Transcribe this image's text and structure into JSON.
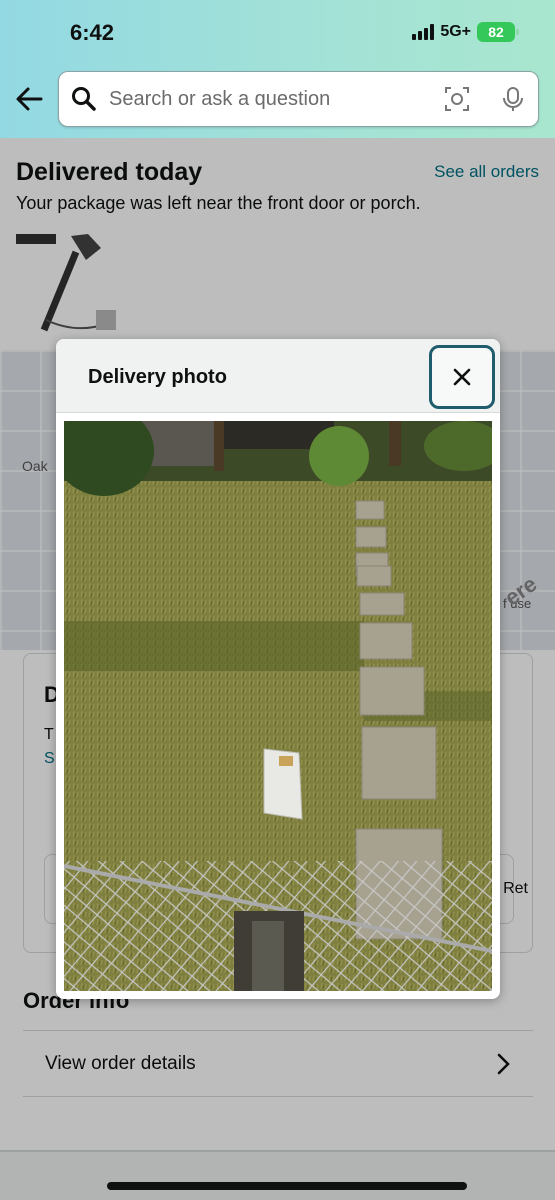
{
  "status": {
    "time": "6:42",
    "network": "5G+",
    "battery": "82"
  },
  "header": {
    "search_placeholder": "Search or ask a question"
  },
  "page": {
    "title": "Delivered today",
    "see_all": "See all orders",
    "subtitle": "Your package was left near the front door or porch.",
    "map_label_oak": "Oak",
    "map_label_use": "f use",
    "map_label_ere": "ere",
    "card_heading_partial": "D",
    "card_line1_partial": "T",
    "card_line2_partial": "S",
    "card_return_partial": "Ret"
  },
  "order_info": {
    "title": "Order info",
    "view_details": "View order details"
  },
  "modal": {
    "title": "Delivery photo"
  }
}
